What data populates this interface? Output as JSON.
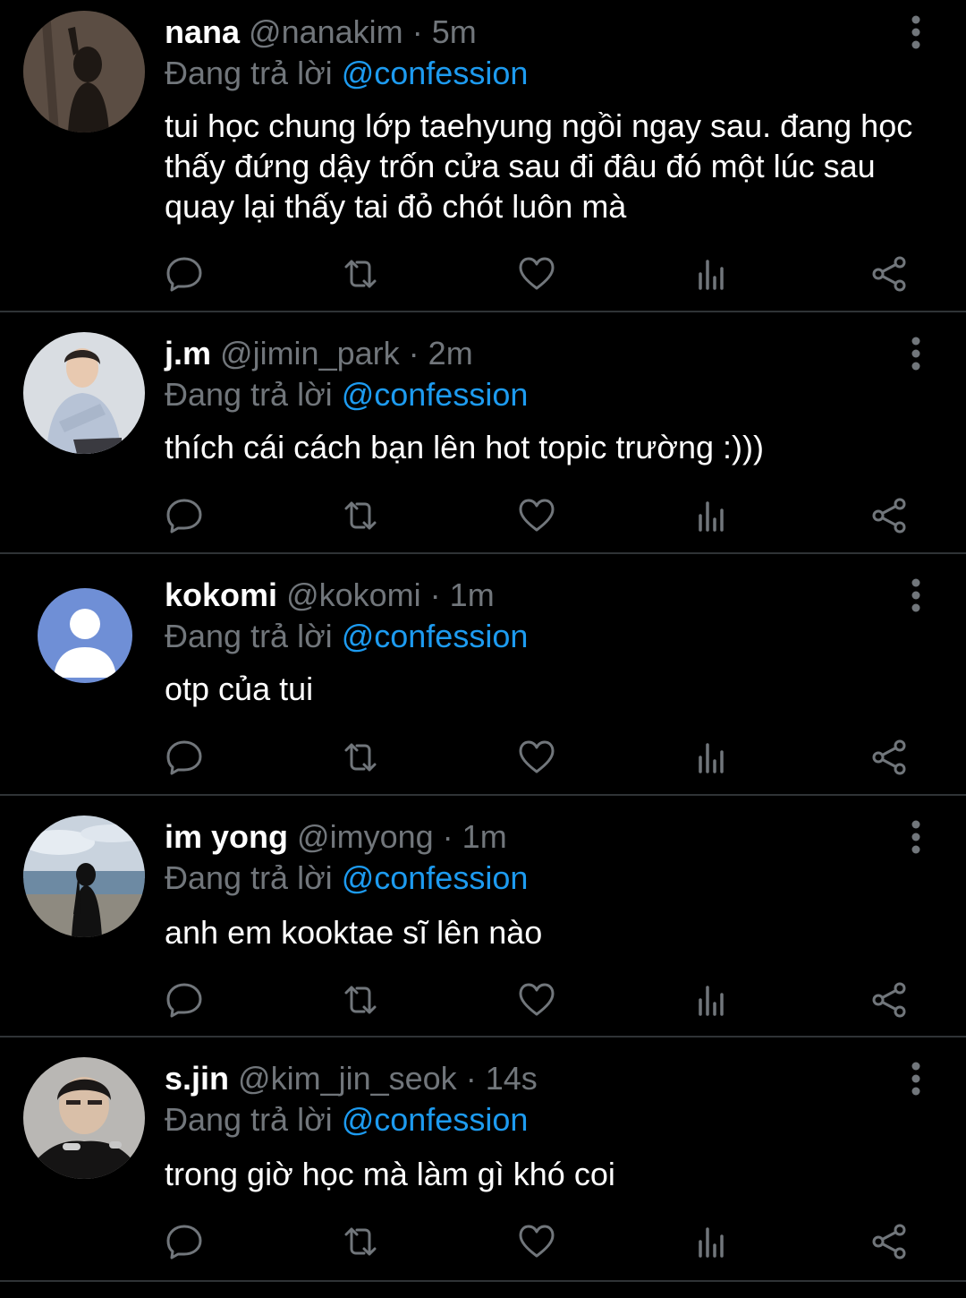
{
  "replying_prefix": "Đang trả lời",
  "colors": {
    "background": "#000000",
    "text": "#ffffff",
    "muted": "#71767b",
    "accent": "#1d9bf0",
    "divider": "#2f3336"
  },
  "icons": {
    "reply": "reply-icon",
    "retweet": "retweet-icon",
    "like": "heart-icon",
    "views": "analytics-icon",
    "share": "share-icon",
    "more": "more-vertical-icon"
  },
  "tweets": [
    {
      "name": "nana",
      "handle": "@nanakim",
      "time": "5m",
      "mention": "@confession",
      "text": "tui học chung lớp taehyung ngồi ngay sau. đang học thấy đứng dậy trốn cửa sau đi đâu đó một lúc sau quay lại thấy tai đỏ chót luôn mà"
    },
    {
      "name": "j.m",
      "handle": "@jimin_park",
      "time": "2m",
      "mention": "@confession",
      "text": "thích cái cách bạn lên hot topic trường :)))"
    },
    {
      "name": "kokomi",
      "handle": "@kokomi",
      "time": "1m",
      "mention": "@confession",
      "text": "otp của tui"
    },
    {
      "name": "im yong",
      "handle": "@imyong",
      "time": "1m",
      "mention": "@confession",
      "text": "anh em kooktae sĩ lên nào"
    },
    {
      "name": "s.jin",
      "handle": "@kim_jin_seok",
      "time": "14s",
      "mention": "@confession",
      "text": "trong giờ học mà làm gì khó coi"
    }
  ]
}
